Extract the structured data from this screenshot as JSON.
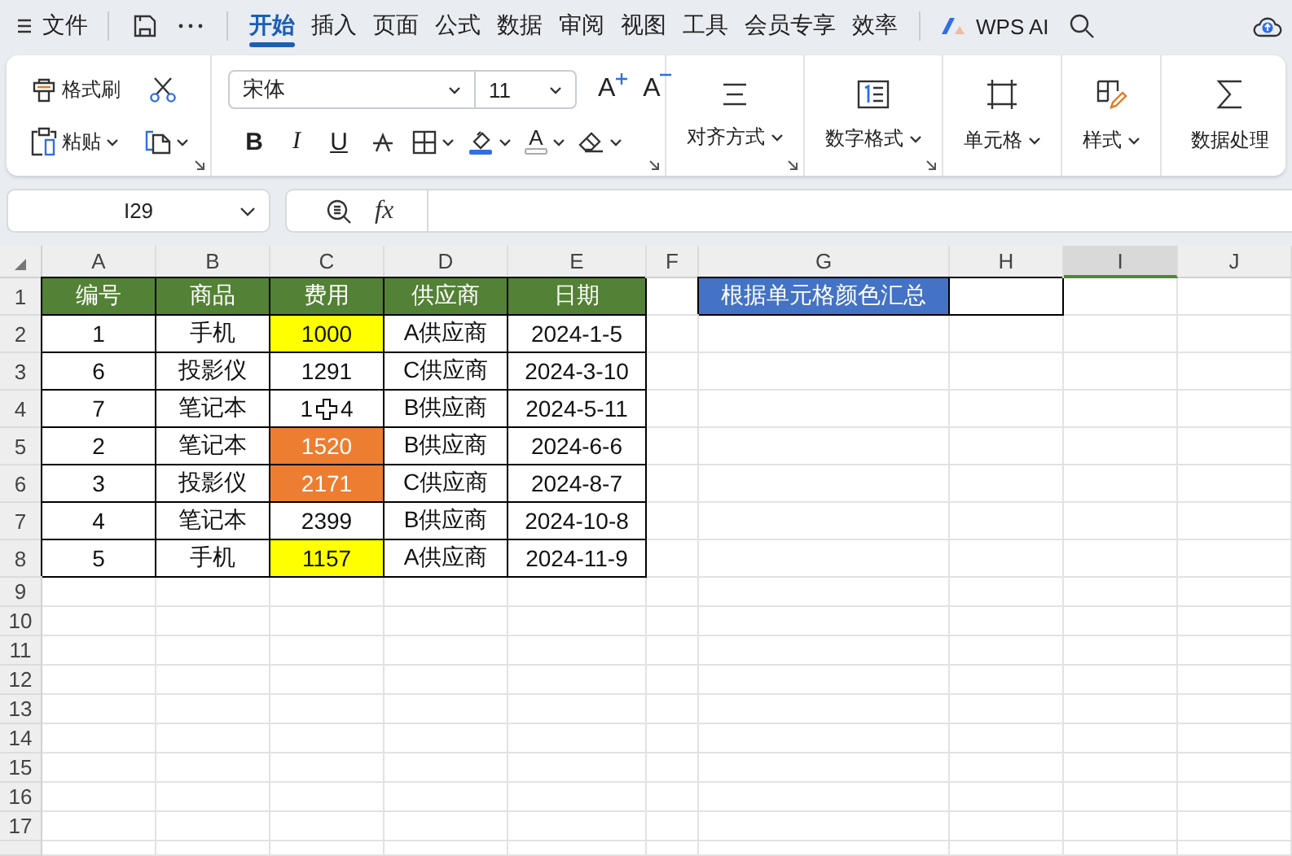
{
  "menubar": {
    "file": "文件",
    "tabs": [
      {
        "label": "开始",
        "selected": true
      },
      {
        "label": "插入",
        "selected": false
      },
      {
        "label": "页面",
        "selected": false
      },
      {
        "label": "公式",
        "selected": false
      },
      {
        "label": "数据",
        "selected": false
      },
      {
        "label": "审阅",
        "selected": false
      },
      {
        "label": "视图",
        "selected": false
      },
      {
        "label": "工具",
        "selected": false
      },
      {
        "label": "会员专享",
        "selected": false
      },
      {
        "label": "效率",
        "selected": false
      }
    ],
    "ai_label": "WPS AI"
  },
  "ribbon": {
    "format_painter": "格式刷",
    "paste": "粘贴",
    "font_name": "宋体",
    "font_size": "11",
    "grow_font": "A",
    "shrink_font": "A",
    "bold": "B",
    "italic": "I",
    "underline": "U",
    "font_color": "A",
    "groups": [
      {
        "kind": "align",
        "label": "对齐方式"
      },
      {
        "kind": "number",
        "label": "数字格式"
      },
      {
        "kind": "cell",
        "label": "单元格"
      },
      {
        "kind": "style",
        "label": "样式"
      },
      {
        "kind": "sum",
        "label": "数据处理"
      }
    ]
  },
  "formula_bar": {
    "name_box": "I29",
    "fx": "fx"
  },
  "sheet": {
    "columns": [
      {
        "label": "A",
        "selected": false
      },
      {
        "label": "B",
        "selected": false
      },
      {
        "label": "C",
        "selected": false
      },
      {
        "label": "D",
        "selected": false
      },
      {
        "label": "E",
        "selected": false
      },
      {
        "label": "F",
        "selected": false
      },
      {
        "label": "G",
        "selected": false
      },
      {
        "label": "H",
        "selected": false
      },
      {
        "label": "I",
        "selected": true
      },
      {
        "label": "J",
        "selected": false
      }
    ],
    "rows": [
      {
        "label": "1",
        "cells": [
          {
            "value": "编号",
            "bordered": true,
            "color": "#538135"
          },
          {
            "value": "商品",
            "bordered": true,
            "color": "#538135"
          },
          {
            "value": "费用",
            "bordered": true,
            "color": "#538135"
          },
          {
            "value": "供应商",
            "bordered": true,
            "color": "#538135"
          },
          {
            "value": "日期",
            "bordered": true,
            "color": "#538135"
          },
          {
            "bordered": false
          },
          {
            "value": "根据单元格颜色汇总",
            "bordered": true,
            "color": "#4472c4"
          },
          {
            "bordered": true
          }
        ]
      },
      {
        "label": "2",
        "cells": [
          {
            "value": "1",
            "bordered": true
          },
          {
            "value": "手机",
            "bordered": true
          },
          {
            "value": "1000",
            "bordered": true,
            "color": "#ffff00"
          },
          {
            "value": "A供应商",
            "bordered": true
          },
          {
            "value": "2024-1-5",
            "bordered": true
          }
        ]
      },
      {
        "label": "3",
        "cells": [
          {
            "value": "6",
            "bordered": true
          },
          {
            "value": "投影仪",
            "bordered": true
          },
          {
            "value": "1291",
            "bordered": true
          },
          {
            "value": "C供应商",
            "bordered": true
          },
          {
            "value": "2024-3-10",
            "bordered": true
          }
        ]
      },
      {
        "label": "4",
        "cells": [
          {
            "value": "7",
            "bordered": true
          },
          {
            "value": "笔记本",
            "bordered": true
          },
          {
            "parts": [
              "1",
              "4"
            ],
            "cursor": true,
            "bordered": true
          },
          {
            "value": "B供应商",
            "bordered": true
          },
          {
            "value": "2024-5-11",
            "bordered": true
          }
        ]
      },
      {
        "label": "5",
        "cells": [
          {
            "value": "2",
            "bordered": true
          },
          {
            "value": "笔记本",
            "bordered": true
          },
          {
            "value": "1520",
            "bordered": true,
            "color": "#ed7d31"
          },
          {
            "value": "B供应商",
            "bordered": true
          },
          {
            "value": "2024-6-6",
            "bordered": true
          }
        ]
      },
      {
        "label": "6",
        "cells": [
          {
            "value": "3",
            "bordered": true
          },
          {
            "value": "投影仪",
            "bordered": true
          },
          {
            "value": "2171",
            "bordered": true,
            "color": "#ed7d31"
          },
          {
            "value": "C供应商",
            "bordered": true
          },
          {
            "value": "2024-8-7",
            "bordered": true
          }
        ]
      },
      {
        "label": "7",
        "cells": [
          {
            "value": "4",
            "bordered": true
          },
          {
            "value": "笔记本",
            "bordered": true
          },
          {
            "value": "2399",
            "bordered": true
          },
          {
            "value": "B供应商",
            "bordered": true
          },
          {
            "value": "2024-10-8",
            "bordered": true
          }
        ]
      },
      {
        "label": "8",
        "cells": [
          {
            "value": "5",
            "bordered": true
          },
          {
            "value": "手机",
            "bordered": true
          },
          {
            "value": "1157",
            "bordered": true,
            "color": "#ffff00"
          },
          {
            "value": "A供应商",
            "bordered": true
          },
          {
            "value": "2024-11-9",
            "bordered": true
          }
        ]
      },
      {
        "label": "9"
      },
      {
        "label": "10"
      },
      {
        "label": "11"
      },
      {
        "label": "12"
      },
      {
        "label": "13"
      },
      {
        "label": "14"
      },
      {
        "label": "15"
      },
      {
        "label": "16"
      },
      {
        "label": "17"
      }
    ]
  }
}
